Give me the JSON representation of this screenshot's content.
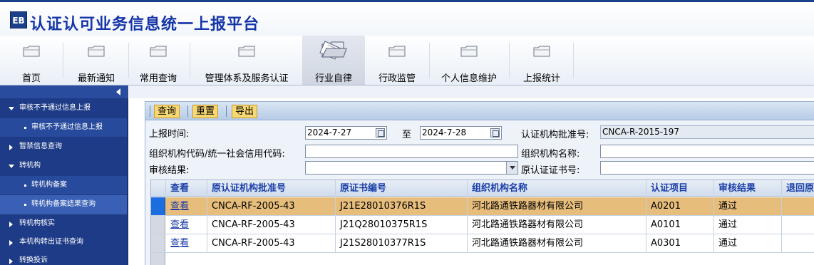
{
  "app": {
    "logo_text": "EB",
    "title": "认证认可业务信息统一上报平台"
  },
  "nav": {
    "items": [
      {
        "label": "首页",
        "icon": "folder-icon"
      },
      {
        "label": "最新通知",
        "icon": "folder-icon"
      },
      {
        "label": "常用查询",
        "icon": "folder-icon"
      },
      {
        "label": "管理体系及服务认证",
        "icon": "folder-icon"
      },
      {
        "label": "行业自律",
        "icon": "open-folder-icon"
      },
      {
        "label": "行政监管",
        "icon": "folder-icon"
      },
      {
        "label": "个人信息维护",
        "icon": "folder-icon"
      },
      {
        "label": "上报统计",
        "icon": "folder-icon"
      }
    ],
    "active": "行业自律"
  },
  "sidebar": {
    "items": [
      {
        "label": "审核不予通过信息上报",
        "type": "group",
        "expanded": true
      },
      {
        "label": "审核不予通过信息上报",
        "type": "sub"
      },
      {
        "label": "暂禁信息查询",
        "type": "group",
        "expanded": false
      },
      {
        "label": "转机构",
        "type": "group",
        "expanded": true
      },
      {
        "label": "转机构备案",
        "type": "sub"
      },
      {
        "label": "转机构备案结果查询",
        "type": "sub",
        "selected": true
      },
      {
        "label": "转机构核实",
        "type": "group",
        "expanded": false
      },
      {
        "label": "本机构转出证书查询",
        "type": "group",
        "expanded": false
      },
      {
        "label": "转换投诉",
        "type": "group",
        "expanded": false
      }
    ]
  },
  "toolbar": {
    "query": "查询",
    "reset": "重置",
    "export": "导出"
  },
  "form": {
    "report_time_label": "上报时间:",
    "date_from": "2024-7-27",
    "to_label": "至",
    "date_to": "2024-7-28",
    "approval_no_label": "认证机构批准号:",
    "approval_no": "CNCA-R-2015-197",
    "org_code_label": "组织机构代码/统一社会信用代码:",
    "org_code": "",
    "org_name_label": "组织机构名称:",
    "org_name": "",
    "review_result_label": "审核结果:",
    "review_result": "",
    "orig_cert_label": "原认证证书号:",
    "orig_cert": ""
  },
  "grid": {
    "columns": [
      "查看",
      "原认证机构批准号",
      "原证书编号",
      "组织机构名称",
      "认证项目",
      "审核结果",
      "退回原"
    ],
    "rows": [
      {
        "view": "查看",
        "orig_approval": "CNCA-RF-2005-43",
        "orig_cert": "J21E28010376R1S",
        "org_name": "河北路通铁路器材有限公司",
        "project": "A0201",
        "result": "通过",
        "returned": ""
      },
      {
        "view": "查看",
        "orig_approval": "CNCA-RF-2005-43",
        "orig_cert": "J21Q28010375R1S",
        "org_name": "河北路通铁路器材有限公司",
        "project": "A0101",
        "result": "通过",
        "returned": ""
      },
      {
        "view": "查看",
        "orig_approval": "CNCA-RF-2005-43",
        "orig_cert": "J21S28010377R1S",
        "org_name": "河北路通铁路器材有限公司",
        "project": "A0301",
        "result": "通过",
        "returned": ""
      }
    ]
  },
  "colors": {
    "brand": "#1535a8",
    "sidebar": "#1d3b86",
    "button": "#f7d873",
    "selected_row": "#e7bd7c"
  }
}
